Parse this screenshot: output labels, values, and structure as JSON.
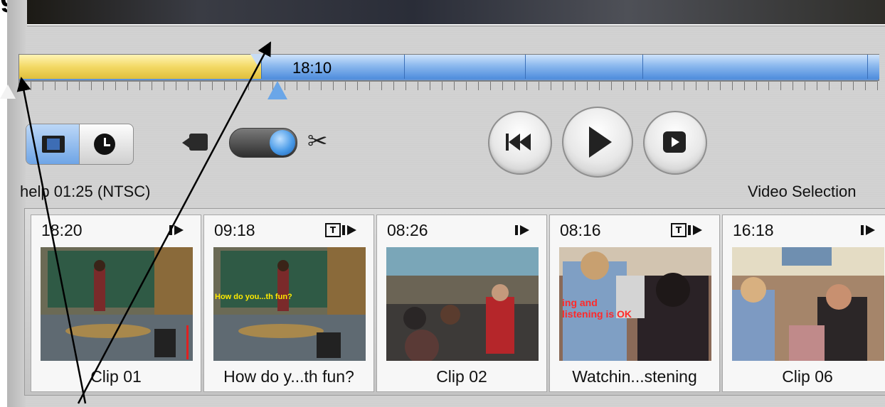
{
  "timeline": {
    "playhead_time": "18:10"
  },
  "status": {
    "left": "help  01:25 (NTSC)",
    "right": "Video Selection"
  },
  "clips": [
    {
      "time": "18:20",
      "name": "Clip 01",
      "has_title": false,
      "overlay": ""
    },
    {
      "time": "09:18",
      "name": "How do y...th fun?",
      "has_title": true,
      "overlay": "How do you...th fun?"
    },
    {
      "time": "08:26",
      "name": "Clip 02",
      "has_title": false,
      "overlay": ""
    },
    {
      "time": "08:16",
      "name": "Watchin...stening",
      "has_title": true,
      "overlay": "ing and listening is OK"
    },
    {
      "time": "16:18",
      "name": "Clip 06",
      "has_title": false,
      "overlay": ""
    }
  ],
  "colors": {
    "timeline_selected": "#f3d965",
    "timeline_clip": "#8cb9ee",
    "toggle_active": "#6fa5e6"
  },
  "icons": [
    "film-icon",
    "clock-icon",
    "camera-icon",
    "scissors-icon",
    "rewind-icon",
    "play-icon",
    "fullscreen-play-icon",
    "clip-play-icon",
    "title-icon"
  ]
}
